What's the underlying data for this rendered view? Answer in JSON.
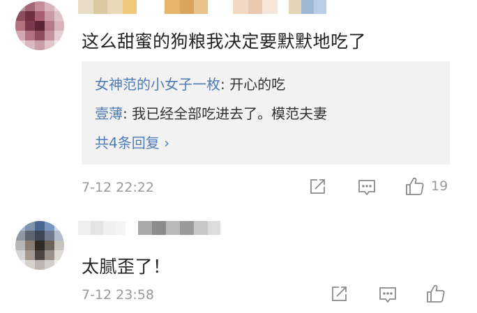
{
  "comments": [
    {
      "text": "这么甜蜜的狗粮我决定要默默地吃了",
      "replies": [
        {
          "author": "女神范的小女子一枚",
          "separator": ":",
          "content": " 开心的吃"
        },
        {
          "author": "壹薄",
          "separator": ":",
          "content": " 我已经全部吃进去了。模范夫妻"
        }
      ],
      "more_replies_label": "共4条回复 ›",
      "timestamp": "7-12 22:22",
      "like_count": "19",
      "icons": {
        "share": "share-icon",
        "reply": "comment-icon",
        "like": "thumbs-up-icon"
      }
    },
    {
      "text": "太腻歪了！",
      "timestamp": "7-12 23:58",
      "like_count": "",
      "icons": {
        "share": "share-icon",
        "reply": "comment-icon",
        "like": "thumbs-up-icon"
      }
    }
  ],
  "colors": {
    "link_blue": "#4f7cb4",
    "meta_gray": "#999999",
    "reply_bg": "#f2f2f2"
  }
}
